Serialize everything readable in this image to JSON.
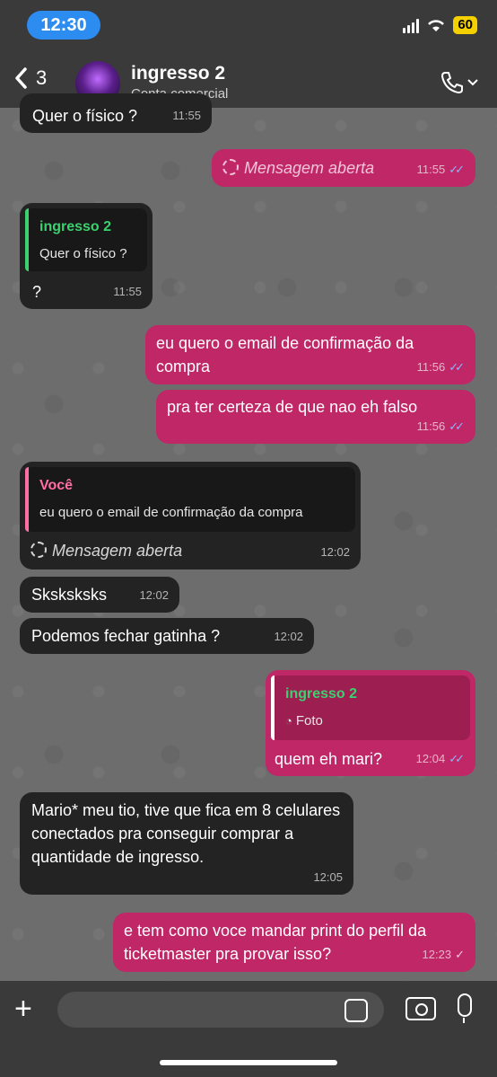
{
  "status_bar": {
    "time": "12:30",
    "battery": "60"
  },
  "header": {
    "back_count": "3",
    "contact_name": "ingresso 2",
    "contact_subtitle": "Conta comercial"
  },
  "messages": [
    {
      "id": "m1",
      "direction": "in",
      "text": "Quer o físico ?",
      "time": "11:55"
    },
    {
      "id": "m2",
      "direction": "out",
      "text": "Mensagem aberta",
      "time": "11:55",
      "status": "read"
    },
    {
      "id": "m3",
      "direction": "in",
      "quote_author": "ingresso 2",
      "quote_text": "Quer o físico ?",
      "text": "?",
      "time": "11:55"
    },
    {
      "id": "m4",
      "direction": "out",
      "text": "eu quero o email de confirmação da compra",
      "time": "11:56",
      "status": "read"
    },
    {
      "id": "m5",
      "direction": "out",
      "text": "pra ter certeza de que nao eh falso",
      "time": "11:56",
      "status": "read"
    },
    {
      "id": "m6",
      "direction": "in",
      "quote_author": "Você",
      "quote_text": "eu quero o email de confirmação da compra",
      "text": "Mensagem aberta",
      "time": "12:02"
    },
    {
      "id": "m7",
      "direction": "in",
      "text": "Sksksksks",
      "time": "12:02"
    },
    {
      "id": "m8",
      "direction": "in",
      "text": "Podemos fechar gatinha ?",
      "time": "12:02"
    },
    {
      "id": "m9",
      "direction": "out",
      "quote_author": "ingresso 2",
      "quote_text": "Foto",
      "text": "quem eh mari?",
      "time": "12:04",
      "status": "read"
    },
    {
      "id": "m10",
      "direction": "in",
      "text": "Mario* meu tio, tive que fica em 8 celulares conectados pra conseguir comprar a quantidade de ingresso.",
      "time": "12:05"
    },
    {
      "id": "m11",
      "direction": "out",
      "text": "e tem como voce mandar print do perfil da ticketmaster pra provar isso?",
      "time": "12:23",
      "status": "sent"
    }
  ],
  "icons": {
    "back": "chevron-left-icon",
    "call": "phone-icon",
    "plus": "plus-icon",
    "sticker": "sticker-icon",
    "camera": "camera-icon",
    "mic": "microphone-icon"
  },
  "colors": {
    "outgoing": "#c02767",
    "incoming": "#232323",
    "quote_green": "#3bd16f",
    "quote_pink": "#ff6fa4",
    "status_time": "#2d8cf0",
    "battery": "#f4d000",
    "read_ticks": "#8ab4ff"
  }
}
